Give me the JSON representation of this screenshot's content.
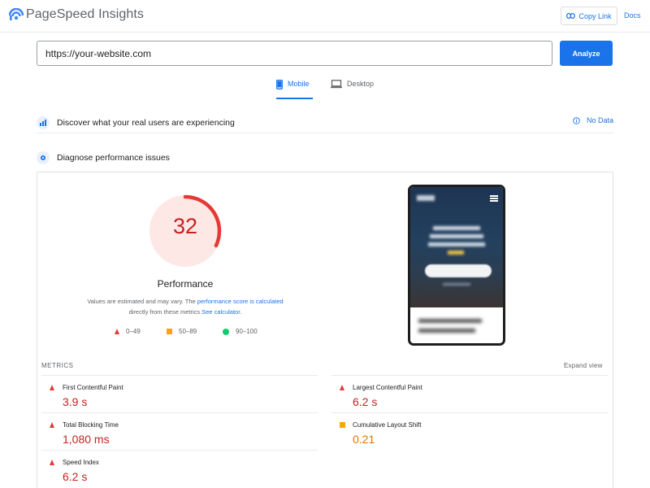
{
  "header": {
    "app_title": "PageSpeed Insights",
    "copy_link_label": "Copy Link",
    "docs_label": "Docs"
  },
  "search": {
    "url_value": "https://your-website.com",
    "analyze_label": "Analyze"
  },
  "tabs": [
    {
      "label": "Mobile",
      "active": true
    },
    {
      "label": "Desktop",
      "active": false
    }
  ],
  "sections": {
    "discover_title": "Discover what your real users are experiencing",
    "no_data_label": "No Data",
    "diagnose_title": "Diagnose performance issues"
  },
  "performance": {
    "score": "32",
    "score_fraction": 0.32,
    "label": "Performance",
    "note_prefix": "Values are estimated and may vary. The ",
    "note_link1": "performance score is calculated",
    "note_middle": "directly from these metrics.",
    "note_link2": "See calculator."
  },
  "legend": [
    {
      "range": "0–49",
      "shape": "triangle",
      "color": "#e53935"
    },
    {
      "range": "50–89",
      "shape": "square",
      "color": "#ffa400"
    },
    {
      "range": "90–100",
      "shape": "circle",
      "color": "#0cce6b"
    }
  ],
  "metrics": {
    "header": "METRICS",
    "expand_label": "Expand view",
    "items": [
      {
        "name": "First Contentful Paint",
        "value": "3.9 s",
        "status": "poor"
      },
      {
        "name": "Largest Contentful Paint",
        "value": "6.2 s",
        "status": "poor"
      },
      {
        "name": "Total Blocking Time",
        "value": "1,080 ms",
        "status": "poor"
      },
      {
        "name": "Cumulative Layout Shift",
        "value": "0.21",
        "status": "average"
      },
      {
        "name": "Speed Index",
        "value": "6.2 s",
        "status": "poor"
      }
    ]
  },
  "colors": {
    "accent": "#1a73e8",
    "poor": "#c5221f",
    "average": "#e37400",
    "gauge_bg": "#fde8e6",
    "gauge_arc": "#e53935"
  }
}
